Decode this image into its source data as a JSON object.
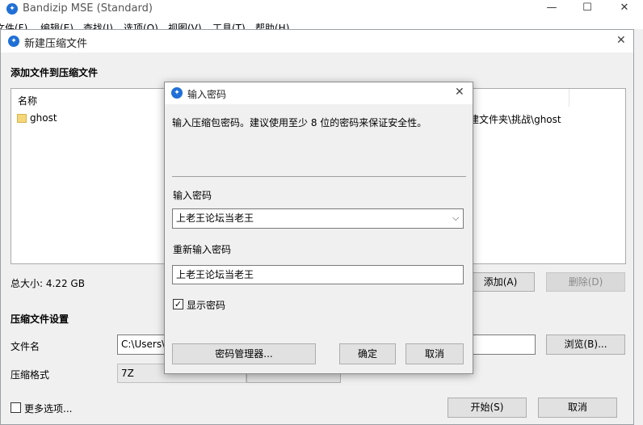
{
  "main_window": {
    "title": "Bandizip MSE (Standard)",
    "minimize_glyph": "—",
    "maximize_glyph": "☐",
    "close_glyph": "✕",
    "menu": [
      "文件(F)",
      "编辑(E)",
      "查找(I)",
      "选项(O)",
      "视图(V)",
      "工具(T)",
      "帮助(H)"
    ]
  },
  "new_archive_dialog": {
    "title": "新建压缩文件",
    "close_glyph": "✕",
    "section_add": "添加文件到压缩文件",
    "list_header_name": "名称",
    "list_items": [
      {
        "name": "ghost",
        "path": "建文件夹\\挑战\\ghost"
      }
    ],
    "total_size": "总大小: 4.22 GB",
    "add_button": "添加(A)",
    "delete_button": "删除(D)",
    "section_settings": "压缩文件设置",
    "filename_label": "文件名",
    "filename_value": "C:\\Users\\",
    "browse_button": "浏览(B)...",
    "format_label": "压缩格式",
    "format_value": "7Z",
    "more_options": "更多选项...",
    "start_button": "开始(S)",
    "cancel_button": "取消"
  },
  "password_dialog": {
    "title": "输入密码",
    "close_glyph": "✕",
    "description": "输入压缩包密码。建议使用至少 8 位的密码来保证安全性。",
    "password_label": "输入密码",
    "password_value": "上老王论坛当老王",
    "repeat_label": "重新输入密码",
    "repeat_value": "上老王论坛当老王",
    "show_password_label": "显示密码",
    "show_password_checked": "✓",
    "manager_button": "密码管理器...",
    "ok_button": "确定",
    "cancel_button": "取消"
  },
  "colors": {
    "accent": "#1f6fd6",
    "border": "#adadad",
    "button": "#e1e1e1"
  }
}
